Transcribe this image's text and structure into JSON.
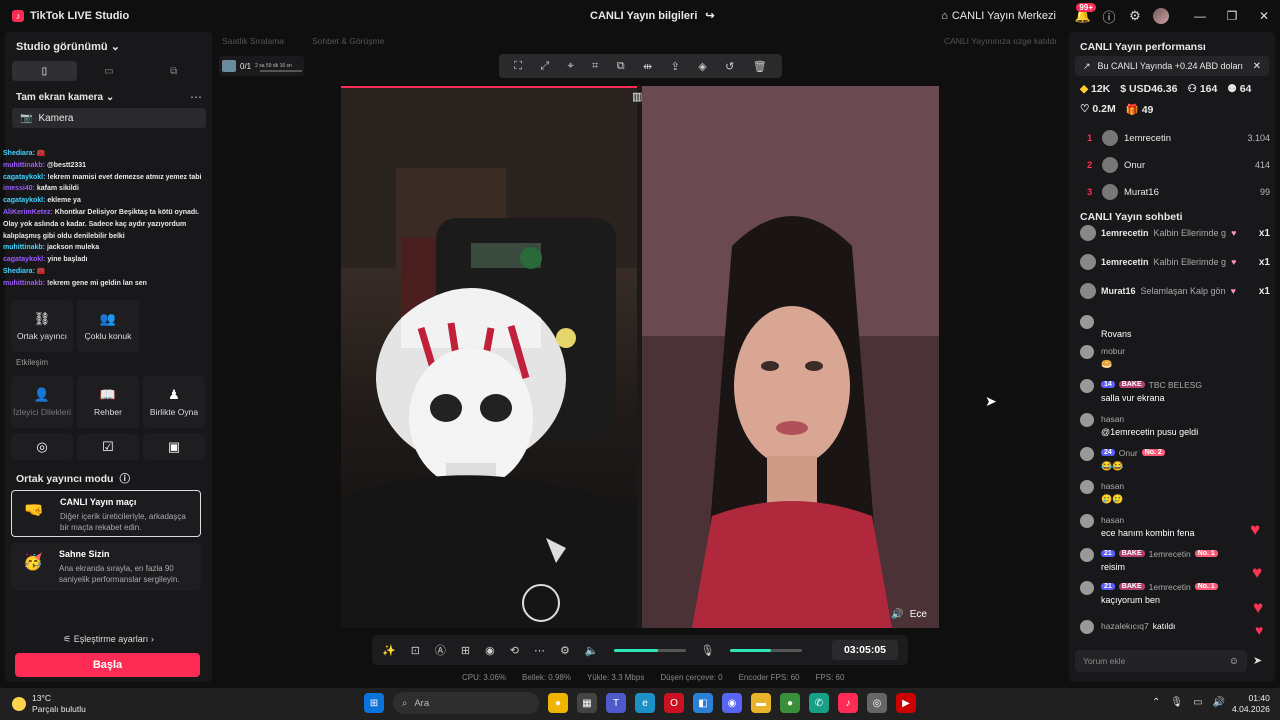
{
  "titlebar": {
    "app_title": "TikTok LIVE Studio",
    "live_info": "CANLI Yayın bilgileri",
    "live_center": "CANLI Yayın Merkezi",
    "notif_count": "99+"
  },
  "left": {
    "view_title": "Studio görünümü",
    "scene_title": "Tam ekran kamera",
    "camera_label": "Kamera",
    "chat_overlay": [
      {
        "user": "Shediara:",
        "text": " 🧰"
      },
      {
        "user": "muhittinakb:",
        "text": " @bestt2331"
      },
      {
        "user": "cagataykokl:",
        "text": " !ekrem mamisi evet demezse atmız yemez tabi"
      },
      {
        "user": "imessi40:",
        "text": " kafam sikildi"
      },
      {
        "user": "cagataykokl:",
        "text": " ekleme ya"
      },
      {
        "user": "AliKerimKetez:",
        "text": " Khontkar Delisiyor Beşiktaş ta kötü oynadı. Olay yok aslında o kadar. Sadece kaç aydır yazıyordum kalıplaşmış gibi oldu denilebilir belki"
      },
      {
        "user": "muhittinakb:",
        "text": " jackson muleka"
      },
      {
        "user": "cagataykokl:",
        "text": " yine başladı"
      },
      {
        "user": "Shediara:",
        "text": " 🧰"
      },
      {
        "user": "muhittinakb:",
        "text": " !ekrem gene mi geldin lan sen"
      }
    ],
    "tools_row1": [
      {
        "icon": "link-icon",
        "label": "Ortak yayıncı"
      },
      {
        "icon": "guests-icon",
        "label": "Çoklu konuk"
      }
    ],
    "interaction_label": "Etkileşim",
    "tools_row2": [
      {
        "icon": "viewer-request-icon",
        "label": "İzleyici Dilekleri",
        "dim": true
      },
      {
        "icon": "guide-icon",
        "label": "Rehber"
      },
      {
        "icon": "play-together-icon",
        "label": "Birlikte Oyna"
      }
    ],
    "cohost_title": "Ortak yayıncı modu",
    "modes": [
      {
        "title": "CANLI Yayın maçı",
        "desc": "Diğer içerik üreticileriyle, arkadaşça bir maçta rekabet edin."
      },
      {
        "title": "Sahne Sizin",
        "desc": "Ana ekranda sırayla, en fazla 90 saniyelik performanslar sergileyin."
      }
    ],
    "match_settings": "Eşleştirme ayarları",
    "start_button": "Başla"
  },
  "center": {
    "faint_1": "Saatlik Sıralama",
    "faint_2": "Sohbet & Görüşme",
    "faint_3": "CANLI Yayınınıza ozge katıldı",
    "goal_count": "0/1",
    "goal_time": "2 sa 59 dk 16 sn",
    "cohost_name": "Ece",
    "timer": "03:05:05",
    "speaker_volume": 0.62,
    "mic_volume": 0.58,
    "stats": [
      "CPU: 3.06%",
      "Bellek: 0.98%",
      "Yükle: 3.3 Mbps",
      "Düşen çerçeve: 0",
      "Encoder FPS: 60",
      "FPS: 60"
    ]
  },
  "right": {
    "perf_title": "CANLI Yayın performansı",
    "banner": "Bu CANLI Yayında +0.24 ABD doları",
    "metrics": [
      "12K",
      "USD46.36",
      "164",
      "64"
    ],
    "metrics2": [
      "0.2M",
      "49"
    ],
    "ranking": [
      {
        "rank": "1",
        "name": "1emrecetin",
        "value": "3.104"
      },
      {
        "rank": "2",
        "name": "Onur",
        "value": "414"
      },
      {
        "rank": "3",
        "name": "Murat16",
        "value": "99"
      }
    ],
    "chat_title": "CANLI Yayın sohbeti",
    "gifts": [
      {
        "user": "1emrecetin",
        "msg": "Kalbin Ellerimde g",
        "count": "x1"
      },
      {
        "user": "1emrecetin",
        "msg": "Kalbin Ellerimde g",
        "count": "x1"
      },
      {
        "user": "Murat16",
        "msg": "Selamlaşan Kalp gön",
        "count": "x1"
      }
    ],
    "comments": [
      {
        "user": "",
        "text": "Rovans"
      },
      {
        "user": "mobur",
        "text": "🥯"
      },
      {
        "user": "TBC BELESG",
        "text": "salla vur ekrana"
      },
      {
        "user": "hasan",
        "text": "@1emrecetin pusu geldi"
      },
      {
        "user": "Onur",
        "text": "😂😂"
      },
      {
        "user": "hasan",
        "text": "🥲🥲"
      },
      {
        "user": "hasan",
        "text": "ece hanım kombin fena"
      },
      {
        "user": "1emrecetin",
        "text": "reisim"
      },
      {
        "user": "1emrecetin",
        "text": "kaçıyorum ben"
      },
      {
        "user": "hazalekıcıq7",
        "text": "katıldı"
      }
    ],
    "badges": {
      "lvl24": "24",
      "lvl21": "21",
      "lvl14": "14",
      "bake": "BAKE",
      "no1": "No. 1",
      "no2": "No. 2"
    },
    "comment_placeholder": "Yorum ekle"
  },
  "taskbar": {
    "temp": "13°C",
    "weather": "Parçalı bulutlu",
    "search": "Ara",
    "time": "01:40",
    "date": "4.04.2026"
  }
}
